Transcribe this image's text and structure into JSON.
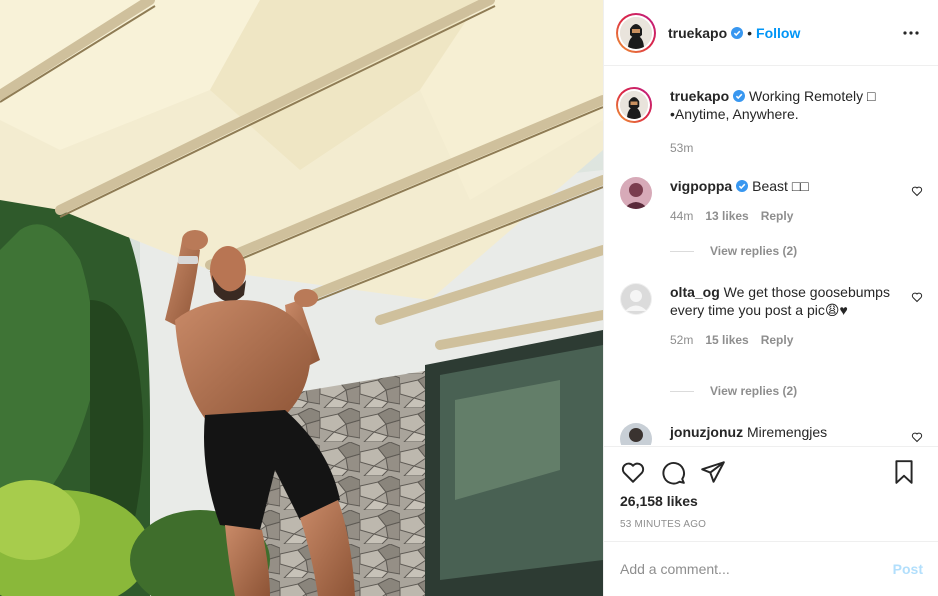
{
  "post": {
    "image_alt": "Man doing pull-ups on pergola beams by a stone wall with greenery",
    "author": "truekapo",
    "author_verified": true,
    "follow_label": "Follow",
    "separator": "•"
  },
  "caption": {
    "username": "truekapo",
    "text": "Working Remotely □",
    "text_line2": "•Anytime, Anywhere.",
    "time": "53m"
  },
  "comments": [
    {
      "username": "vigpoppa",
      "verified": true,
      "text": "Beast □□",
      "time": "44m",
      "likes": "13 likes",
      "reply_label": "Reply",
      "view_replies": "View replies (2)"
    },
    {
      "username": "olta_og",
      "verified": false,
      "text": "We get those goosebumps every time you post a pic😩♥",
      "time": "52m",
      "likes": "15 likes",
      "reply_label": "Reply",
      "view_replies": "View replies (2)"
    },
    {
      "username": "jonuzjonuz",
      "verified": false,
      "text": "Miremengjes"
    }
  ],
  "actions": {
    "likes": "26,158 likes",
    "timestamp": "53 MINUTES AGO"
  },
  "add_comment": {
    "placeholder": "Add a comment...",
    "post_label": "Post"
  },
  "colors": {
    "link": "#0095f6",
    "muted": "#8e8e8e",
    "post_disabled": "#b2dffc"
  },
  "icons": {
    "verified": "verified-badge-icon",
    "more": "more-options-icon",
    "like": "heart-icon",
    "comment": "comment-icon",
    "share": "share-icon",
    "save": "bookmark-icon"
  }
}
